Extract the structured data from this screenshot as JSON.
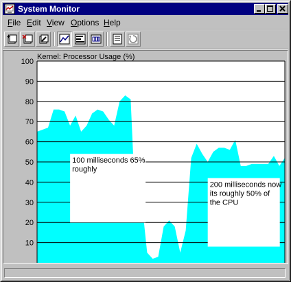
{
  "window": {
    "title": "System Monitor",
    "minimize_icon": "minimize-icon",
    "maximize_icon": "maximize-icon",
    "close_icon": "close-icon"
  },
  "menu": [
    {
      "underline": "F",
      "rest": "ile"
    },
    {
      "underline": "E",
      "rest": "dit"
    },
    {
      "underline": "V",
      "rest": "iew"
    },
    {
      "underline": "O",
      "rest": "ptions"
    },
    {
      "underline": "H",
      "rest": "elp"
    }
  ],
  "toolbar": {
    "icons": [
      "add-counter-icon",
      "remove-counter-icon",
      "edit-counter-icon",
      "line-chart-icon",
      "bar-chart-icon",
      "numeric-display-icon",
      "clear-display-icon",
      "update-now-icon"
    ],
    "pressed": "line-chart-icon"
  },
  "colors": {
    "fill": "#00ffff",
    "plot_bg": "#ffffff",
    "title_bar": "#000080",
    "window_bg": "#c0c0c0"
  },
  "chart_data": {
    "type": "area",
    "title": "Kernel: Processor Usage (%)",
    "ylim": [
      0,
      100
    ],
    "yticks": [
      10,
      20,
      30,
      40,
      50,
      60,
      70,
      80,
      90,
      100
    ],
    "grid": "horizontal",
    "series": [
      {
        "name": "Kernel: Processor Usage (%)",
        "values": [
          65,
          66,
          67,
          76,
          76,
          75,
          68,
          73,
          65,
          68,
          74,
          76,
          75,
          71,
          68,
          80,
          83,
          81,
          20,
          31,
          5,
          2,
          3,
          18,
          21,
          18,
          5,
          16,
          52,
          59,
          54,
          50,
          55,
          57,
          57,
          56,
          61,
          48,
          48,
          49,
          49,
          49,
          49,
          53,
          48,
          52
        ]
      }
    ],
    "annotations": [
      {
        "text": "100 milliseconds 65% roughly",
        "x": 6,
        "y_top": 54,
        "y_bottom": 20
      },
      {
        "text": "200 milliseconds now its roughly 50% of the CPU",
        "x": 31,
        "y_top": 42,
        "y_bottom": 8
      }
    ]
  }
}
